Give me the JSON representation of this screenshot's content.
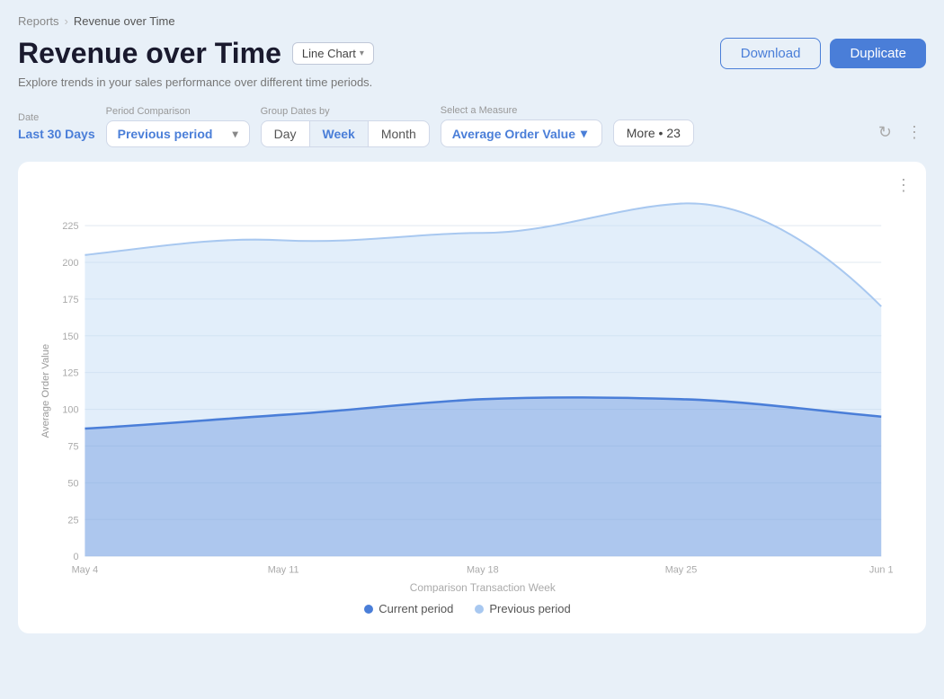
{
  "breadcrumb": {
    "parent": "Reports",
    "current": "Revenue over Time"
  },
  "header": {
    "title": "Revenue over Time",
    "chart_type": "Line Chart",
    "subtitle": "Explore trends in your sales performance over different time periods.",
    "download_label": "Download",
    "duplicate_label": "Duplicate"
  },
  "filters": {
    "date_label": "Date",
    "date_value": "Last 30 Days",
    "period_label": "Period Comparison",
    "period_value": "Previous period",
    "group_label": "Group Dates by",
    "group_options": [
      "Day",
      "Week",
      "Month"
    ],
    "group_active": "Week",
    "measure_label": "Select a Measure",
    "measure_value": "Average Order Value",
    "more_label": "More • 23"
  },
  "chart": {
    "y_label": "Average Order Value",
    "x_label": "Comparison Transaction Week",
    "y_ticks": [
      "0",
      "25",
      "50",
      "75",
      "100",
      "125",
      "150",
      "175",
      "200",
      "225"
    ],
    "x_ticks": [
      "May 4",
      "May 11",
      "May 18",
      "May 25",
      "Jun 1"
    ],
    "legend": {
      "current_label": "Current period",
      "current_color": "#4a7ed8",
      "previous_label": "Previous period",
      "previous_color": "#a8c8f0"
    }
  },
  "icons": {
    "chevron_down": "▾",
    "refresh": "↻",
    "more_vert": "⋮"
  }
}
